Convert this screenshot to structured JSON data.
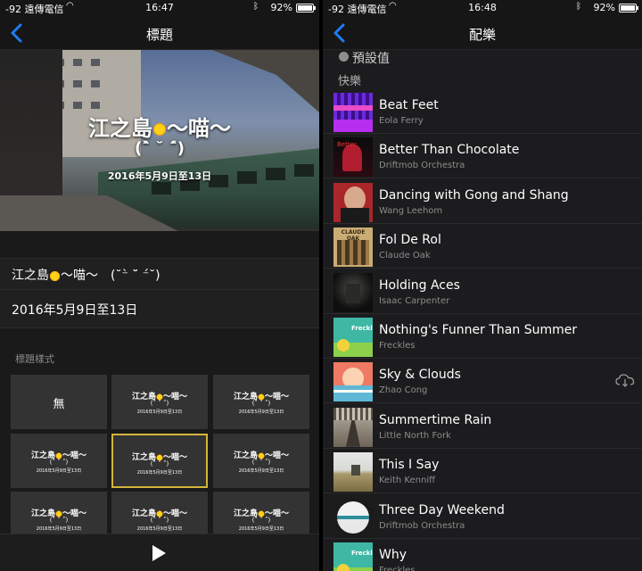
{
  "left": {
    "status": {
      "carrier": "-92 遠傳電信",
      "time": "16:47",
      "battery": "92%",
      "battery_level": 0.92
    },
    "nav": {
      "title": "標題"
    },
    "hero": {
      "title": "江之島",
      "title_suffix": "～喵～",
      "kaomoji": "(ˆ̀ ˘ ˆ́)",
      "date": "2016年5月9日至13日"
    },
    "fields": {
      "title_value_a": "江之島",
      "title_value_b": "～喵～　(˘⁻̀ ˘̈ ⁻́˘)",
      "date_value": "2016年5月9日至13日"
    },
    "style_section_label": "標題樣式",
    "style_none": "無",
    "style_preview": {
      "title_a": "江之島",
      "title_b": "～喵～",
      "kaomoji": "(ˆ̀ ˘ ˆ́)",
      "date": "2016年5月9日至13日"
    },
    "selected_style_index": 4
  },
  "right": {
    "status": {
      "carrier": "-92 遠傳電信",
      "time": "16:48",
      "battery": "92%",
      "battery_level": 0.92
    },
    "nav": {
      "title": "配樂"
    },
    "preset_label": "預設值",
    "group_label": "快樂",
    "songs": [
      {
        "name": "Beat Feet",
        "artist": "Eola Ferry",
        "art": "purple"
      },
      {
        "name": "Better Than Chocolate",
        "artist": "Driftmob Orchestra",
        "art": "red"
      },
      {
        "name": "Dancing with Gong and Shang",
        "artist": "Wang Leehom",
        "art": "portrait"
      },
      {
        "name": "Fol De Rol",
        "artist": "Claude Oak",
        "art": "sepia"
      },
      {
        "name": "Holding Aces",
        "artist": "Isaac Carpenter",
        "art": "dark"
      },
      {
        "name": "Nothing's Funner Than Summer",
        "artist": "Freckles",
        "art": "freckles"
      },
      {
        "name": "Sky & Clouds",
        "artist": "Zhao Cong",
        "art": "sky",
        "cloud_download": true
      },
      {
        "name": "Summertime Rain",
        "artist": "Little North Fork",
        "art": "station"
      },
      {
        "name": "This I Say",
        "artist": "Keith Kenniff",
        "art": "field"
      },
      {
        "name": "Three Day Weekend",
        "artist": "Driftmob Orchestra",
        "art": "circle"
      },
      {
        "name": "Why",
        "artist": "Freckles",
        "art": "freckles"
      }
    ]
  }
}
